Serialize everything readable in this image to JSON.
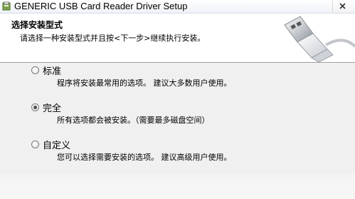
{
  "window": {
    "title": "GENERIC USB Card Reader Driver Setup"
  },
  "banner": {
    "title": "选择安装型式",
    "subtitle": "请选择一种安装型式并且按<下一步>继续执行安装。",
    "graphic_icon": "usb-plug-icon"
  },
  "options": [
    {
      "label": "标准",
      "description": "程序将安装最常用的选项。 建议大多数用户使用。",
      "selected": false
    },
    {
      "label": "完全",
      "description": "所有选项都会被安装。（需要最多磁盘空间）",
      "selected": true
    },
    {
      "label": "自定义",
      "description": "您可以选择需要安装的选项。 建议高级用户使用。",
      "selected": false
    }
  ]
}
